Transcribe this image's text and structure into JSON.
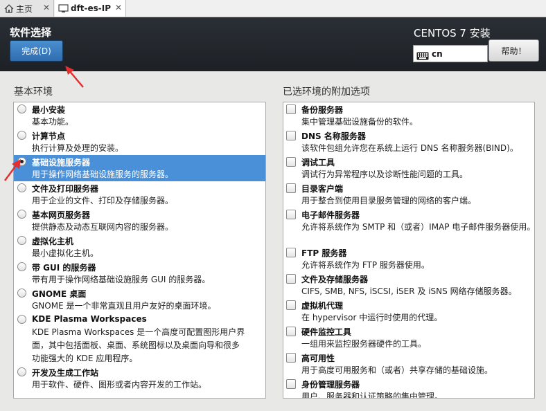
{
  "tabs": [
    {
      "label": "主页",
      "icon": "home-icon"
    },
    {
      "label": "dft-es-IP",
      "icon": "vm-icon"
    }
  ],
  "header": {
    "title": "软件选择",
    "done_label": "完成(D)",
    "product": "CENTOS 7 安装",
    "keyboard_value": "cn",
    "help_label": "帮助！"
  },
  "base_env": {
    "label": "基本环境",
    "items": [
      {
        "title": "最小安装",
        "desc": [
          "基本功能。"
        ],
        "selected": false
      },
      {
        "title": "计算节点",
        "desc": [
          "执行计算及处理的安装。"
        ],
        "selected": false
      },
      {
        "title": "基础设施服务器",
        "desc": [
          "用于操作网络基础设施服务的服务器。"
        ],
        "selected": true
      },
      {
        "title": "文件及打印服务器",
        "desc": [
          "用于企业的文件、打印及存储服务器。"
        ],
        "selected": false
      },
      {
        "title": "基本网页服务器",
        "desc": [
          "提供静态及动态互联网内容的服务器。"
        ],
        "selected": false
      },
      {
        "title": "虚拟化主机",
        "desc": [
          "最小虚拟化主机。"
        ],
        "selected": false
      },
      {
        "title": "带 GUI 的服务器",
        "desc": [
          "带有用于操作网络基础设施服务 GUI 的服务器。"
        ],
        "selected": false
      },
      {
        "title": "GNOME 桌面",
        "desc": [
          "GNOME 是一个非常直观且用户友好的桌面环境。"
        ],
        "selected": false
      },
      {
        "title": "KDE Plasma Workspaces",
        "desc": [
          "KDE Plasma Workspaces 是一个高度可配置图形用户界",
          "面，其中包括面板、桌面、系统图标以及桌面向导和很多",
          "功能强大的 KDE 应用程序。"
        ],
        "selected": false
      },
      {
        "title": "开发及生成工作站",
        "desc": [
          "用于软件、硬件、图形或者内容开发的工作站。"
        ],
        "selected": false
      }
    ]
  },
  "addons": {
    "label": "已选环境的附加选项",
    "items": [
      {
        "title": "备份服务器",
        "desc": "集中管理基础设施备份的软件。",
        "checked": false
      },
      {
        "title": "DNS 名称服务器",
        "desc": "该软件包组允许您在系统上运行 DNS 名称服务器(BIND)。",
        "checked": false
      },
      {
        "title": "调试工具",
        "desc": "调试行为异常程序以及诊断性能问题的工具。",
        "checked": false
      },
      {
        "title": "目录客户端",
        "desc": "用于整合到使用目录服务管理的网络的客户端。",
        "checked": false
      },
      {
        "title": "电子邮件服务器",
        "desc": "允许将系统作为 SMTP 和（或者）IMAP 电子邮件服务器使用。",
        "checked": false
      },
      {
        "title": "FTP 服务器",
        "desc": "允许将系统作为 FTP 服务器使用。",
        "checked": false
      },
      {
        "title": "文件及存储服务器",
        "desc": "CIFS, SMB, NFS, iSCSI, iSER 及 iSNS 网络存储服务器。",
        "checked": false
      },
      {
        "title": "虚拟机代理",
        "desc": "在 hypervisor 中运行时使用的代理。",
        "checked": false
      },
      {
        "title": "硬件监控工具",
        "desc": "一组用来监控服务器硬件的工具。",
        "checked": false
      },
      {
        "title": "高可用性",
        "desc": "用于高度可用服务和（或者）共享存储的基础设施。",
        "checked": false
      },
      {
        "title": "身份管理服务器",
        "desc": "用户、服务器和认证策略的集中管理。",
        "checked": false
      }
    ]
  },
  "colors": {
    "accent": "#4a90d9",
    "header_bg": "#22272c",
    "annotation": "#e03030"
  }
}
